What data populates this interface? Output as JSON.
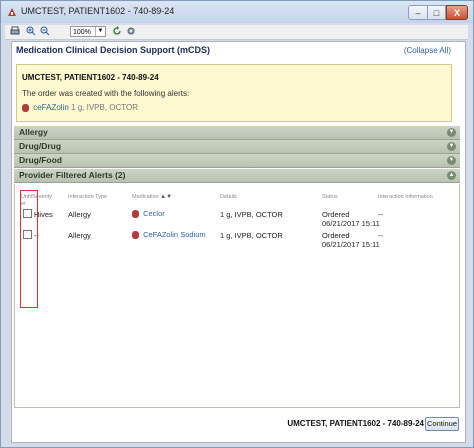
{
  "window": {
    "title": "UMCTEST, PATIENT1602 - 740-89-24",
    "min_label": "–",
    "max_label": "□",
    "close_label": "X"
  },
  "toolbar": {
    "zoom_value": "100%",
    "icons": [
      "print-icon",
      "zoom-in-icon",
      "zoom-out-icon",
      "zoom-select",
      "refresh-icon",
      "settings-icon"
    ]
  },
  "header": {
    "title": "Medication Clinical Decision Support (mCDS)",
    "collapse_all": "(Collapse All)"
  },
  "alert_box": {
    "patient": "UMCTEST, PATIENT1602 - 740-89-24",
    "message": "The order was created with the following alerts:",
    "drug_name": "ceFAZolin",
    "drug_detail": "1 g, IVPB, OCTOR"
  },
  "sections": [
    {
      "label": "Allergy"
    },
    {
      "label": "Drug/Drug"
    },
    {
      "label": "Drug/Food"
    },
    {
      "label": "Provider Filtered Alerts (2)"
    }
  ],
  "table": {
    "headers": {
      "unfilter": "Unfil",
      "unfilter2": "er",
      "severity": "Severity",
      "interaction_type": "Interaction Type",
      "medication": "Medication",
      "details": "Details",
      "status": "Status",
      "interaction_info": "Interaction Information"
    },
    "rows": [
      {
        "severity": "Hives",
        "interaction_type": "Allergy",
        "medication": "Ceclor",
        "details": "1 g, IVPB, OCTOR",
        "status_line1": "Ordered",
        "status_line2": "06/21/2017  15:11",
        "interaction_info": "--"
      },
      {
        "severity": "--",
        "interaction_type": "Allergy",
        "medication": "CeFAZolin Sodium",
        "details": "1 g, IVPB, OCTOR",
        "status_line1": "Ordered",
        "status_line2": "06/21/2017  15:11",
        "interaction_info": "--"
      }
    ]
  },
  "footer": {
    "patient": "UMCTEST, PATIENT1602 - 740-89-24",
    "continue_label": "Continue"
  },
  "colors": {
    "accent_link": "#2b5fb4",
    "alert_bg": "#fdfad2",
    "section_bg": "#c3cbb9",
    "highlight_outline": "#d7333a"
  }
}
